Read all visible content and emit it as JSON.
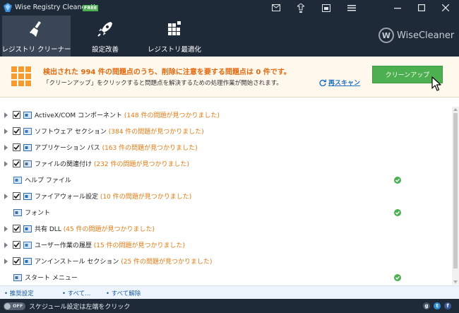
{
  "app": {
    "title": "Wise Registry Cleaner X",
    "badge": "FREE"
  },
  "nav": {
    "tabs": [
      {
        "label": "レジストリ クリーナー",
        "icon": "broom-icon",
        "active": true
      },
      {
        "label": "設定改善",
        "icon": "rocket-icon",
        "active": false
      },
      {
        "label": "レジストリ最適化",
        "icon": "blocks-icon",
        "active": false
      }
    ],
    "brand": "WiseCleaner",
    "brand_logo": "W"
  },
  "summary": {
    "headline": "検出された 994 件の問題点のうち、削除に注意を要する問題点は 0 件です。",
    "subtext": "「クリーンアップ」をクリックすると問題点を解決するための処理作業が開始されます。",
    "rescan": "再スキャン",
    "cleanup": "クリーンアップ"
  },
  "items": [
    {
      "label": "ActiveX/COM コンポーネント",
      "count": "(148 件の問題が見つかりました)",
      "expandable": true,
      "checked": true,
      "icon": "component-icon",
      "ok": false
    },
    {
      "label": "ソフトウェア セクション",
      "count": "(384 件の問題が見つかりました)",
      "expandable": true,
      "checked": true,
      "icon": "software-icon",
      "ok": false
    },
    {
      "label": "アプリケーション パス",
      "count": "(163 件の問題が見つかりました)",
      "expandable": true,
      "checked": true,
      "icon": "app-path-icon",
      "ok": false
    },
    {
      "label": "ファイルの関連付け",
      "count": "(232 件の問題が見つかりました)",
      "expandable": true,
      "checked": true,
      "icon": "file-assoc-icon",
      "ok": false
    },
    {
      "label": "ヘルプ ファイル",
      "count": "",
      "expandable": false,
      "checked": false,
      "icon": "help-file-icon",
      "ok": true
    },
    {
      "label": "ファイアウォール設定",
      "count": "(10 件の問題が見つかりました)",
      "expandable": true,
      "checked": true,
      "icon": "firewall-icon",
      "ok": false
    },
    {
      "label": "フォント",
      "count": "",
      "expandable": false,
      "checked": false,
      "icon": "font-icon",
      "ok": true
    },
    {
      "label": "共有 DLL",
      "count": "(45 件の問題が見つかりました)",
      "expandable": true,
      "checked": true,
      "icon": "dll-icon",
      "ok": false
    },
    {
      "label": "ユーザー作業の履歴",
      "count": "(15 件の問題が見つかりました)",
      "expandable": true,
      "checked": true,
      "icon": "history-icon",
      "ok": false
    },
    {
      "label": "アンインストール セクション",
      "count": "(25 件の問題が見つかりました)",
      "expandable": true,
      "checked": true,
      "icon": "uninstall-icon",
      "ok": false
    },
    {
      "label": "スタート メニュー",
      "count": "",
      "expandable": false,
      "checked": false,
      "icon": "start-menu-icon",
      "ok": true
    }
  ],
  "linkbar": {
    "recommended": "推奨設定",
    "select_all": "すべて...",
    "deselect_all": "すべて解除"
  },
  "status": {
    "toggle": "OFF",
    "text": "スケジュール設定は左端をクリック",
    "social": [
      "g",
      "t",
      "f"
    ]
  },
  "colors": {
    "dark": "#1f2a38",
    "accent_orange": "#e06a10",
    "green": "#4caf50",
    "link_blue": "#1b6ec2"
  }
}
